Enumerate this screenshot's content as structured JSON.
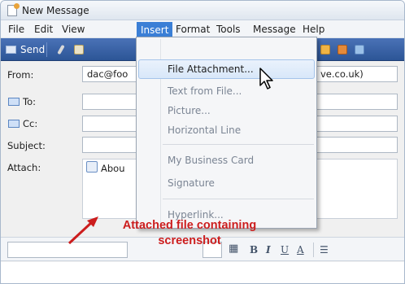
{
  "window": {
    "title": "New Message"
  },
  "menubar": {
    "items": [
      {
        "label": "File"
      },
      {
        "label": "Edit"
      },
      {
        "label": "View"
      },
      {
        "label": "Insert"
      },
      {
        "label": "Format"
      },
      {
        "label": "Tools"
      },
      {
        "label": "Message"
      },
      {
        "label": "Help"
      }
    ],
    "active_index": 3
  },
  "toolbar": {
    "send_label": "Send"
  },
  "form": {
    "from_label": "From:",
    "from_value": "dac@foo",
    "from_value_tail": "ve.co.uk)",
    "to_label": "To:",
    "cc_label": "Cc:",
    "subject_label": "Subject:",
    "attach_label": "Attach:",
    "attach_value": "Abou"
  },
  "insert_menu": {
    "items": [
      {
        "label": "File Attachment...",
        "enabled": true
      },
      {
        "label": "Text from File...",
        "enabled": false
      },
      {
        "label": "Picture...",
        "enabled": false
      },
      {
        "label": "Horizontal Line",
        "enabled": false
      },
      {
        "label": "My Business Card",
        "enabled": false
      },
      {
        "label": "Signature",
        "enabled": false
      },
      {
        "label": "Hyperlink...",
        "enabled": false
      }
    ]
  },
  "formatbar": {
    "bold": "B",
    "italic": "I",
    "underline": "U",
    "font_color": "A"
  },
  "annotation": {
    "line1": "Attached file containing",
    "line2": "screenshot",
    "color": "#cc1d1d"
  },
  "colors": {
    "toolbar": "#2c5596",
    "menu_highlight": "#3b7fd6",
    "annotation": "#cc1d1d"
  }
}
